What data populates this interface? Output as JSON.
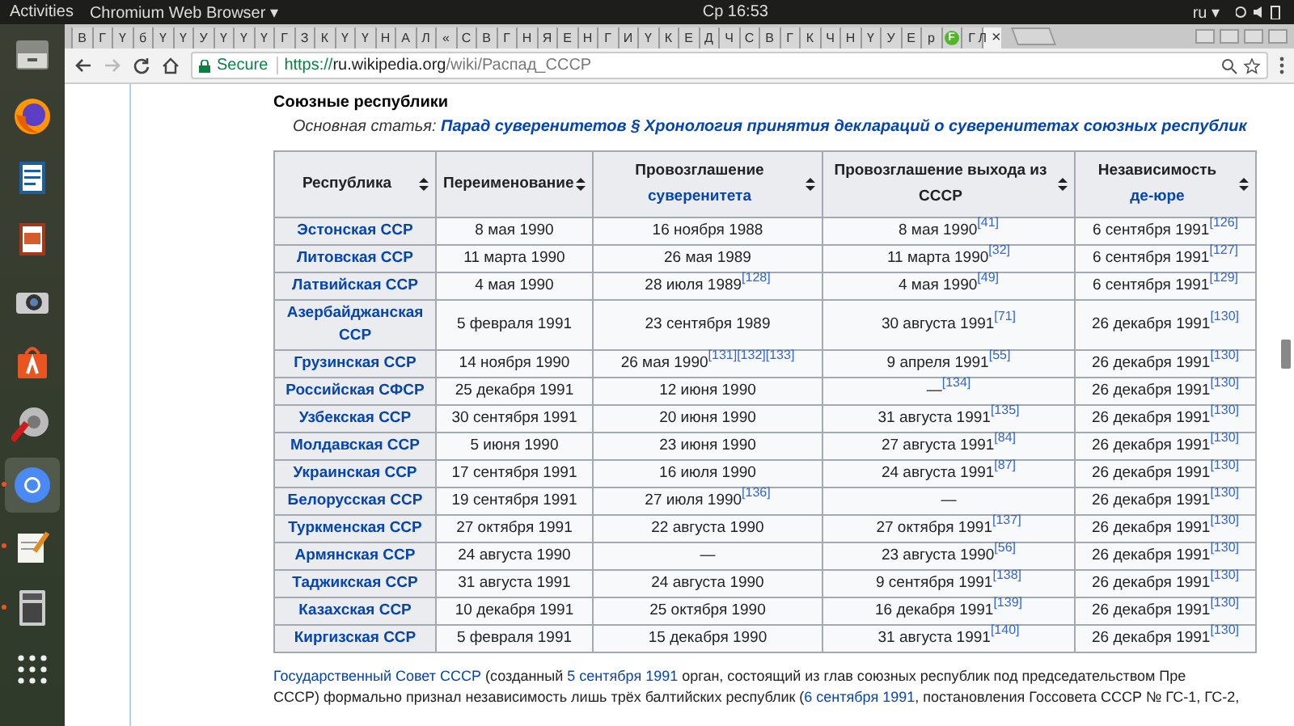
{
  "top_bar": {
    "activities": "Activities",
    "app_menu": "Chromium Web Browser ▾",
    "clock": "Ср 16:53",
    "keyboard": "ru ▾"
  },
  "dock": [
    {
      "kind": "files",
      "running": false,
      "selected": false
    },
    {
      "kind": "firefox",
      "running": false,
      "selected": false
    },
    {
      "kind": "writer",
      "running": false,
      "selected": false
    },
    {
      "kind": "impress",
      "running": false,
      "selected": false
    },
    {
      "kind": "camera",
      "running": false,
      "selected": false
    },
    {
      "kind": "software",
      "running": false,
      "selected": false
    },
    {
      "kind": "settings",
      "running": false,
      "selected": false
    },
    {
      "kind": "chromium",
      "running": true,
      "selected": true
    },
    {
      "kind": "editor",
      "running": true,
      "selected": false
    },
    {
      "kind": "calculator",
      "running": true,
      "selected": false
    },
    {
      "kind": "apps",
      "running": false,
      "selected": false
    }
  ],
  "tabs": [
    {
      "label": "В",
      "selected": false
    },
    {
      "label": "Г",
      "selected": false
    },
    {
      "label": "Ү",
      "selected": false
    },
    {
      "label": "б",
      "selected": false
    },
    {
      "label": "Ү",
      "selected": false
    },
    {
      "label": "Ү",
      "selected": false
    },
    {
      "label": "У",
      "selected": false
    },
    {
      "label": "Ү",
      "selected": false
    },
    {
      "label": "Ү",
      "selected": false
    },
    {
      "label": "Ү",
      "selected": false
    },
    {
      "label": "Г",
      "selected": false
    },
    {
      "label": "З",
      "selected": false
    },
    {
      "label": "К",
      "selected": false
    },
    {
      "label": "Ү",
      "selected": false
    },
    {
      "label": "Ү",
      "selected": false
    },
    {
      "label": "Н",
      "selected": false
    },
    {
      "label": "А",
      "selected": false
    },
    {
      "label": "Л",
      "selected": false
    },
    {
      "label": "«",
      "selected": false
    },
    {
      "label": "С",
      "selected": false
    },
    {
      "label": "В",
      "selected": false
    },
    {
      "label": "Г",
      "selected": false
    },
    {
      "label": "Н",
      "selected": false
    },
    {
      "label": "Я",
      "selected": false
    },
    {
      "label": "Е",
      "selected": false
    },
    {
      "label": "Н",
      "selected": false
    },
    {
      "label": "Г",
      "selected": false
    },
    {
      "label": "И",
      "selected": false
    },
    {
      "label": "Ү",
      "selected": false
    },
    {
      "label": "К",
      "selected": false
    },
    {
      "label": "Е",
      "selected": false
    },
    {
      "label": "Д",
      "selected": false
    },
    {
      "label": "Ч",
      "selected": false
    },
    {
      "label": "С",
      "selected": false
    },
    {
      "label": "В",
      "selected": false
    },
    {
      "label": "Г",
      "selected": false
    },
    {
      "label": "К",
      "selected": false
    },
    {
      "label": "Ч",
      "selected": false
    },
    {
      "label": "Н",
      "selected": false
    },
    {
      "label": "Ү",
      "selected": false
    },
    {
      "label": "У",
      "selected": false
    },
    {
      "label": "Е",
      "selected": false
    },
    {
      "label": "р",
      "selected": false
    },
    {
      "label": "F",
      "selected": false,
      "color": "#52b52a"
    },
    {
      "label": "Г",
      "selected": false
    },
    {
      "label": "Л",
      "selected": true
    }
  ],
  "tab_close": "×",
  "address_bar": {
    "secure": "Secure",
    "scheme": "https://",
    "host": "ru.wikipedia.org",
    "path": "/wiki/Распад_СССР"
  },
  "article": {
    "heading": "Союзные республики",
    "main_article": {
      "label": "Основная статья:",
      "link": "Парад суверенитетов § Хронология принятия деклараций о суверенитетах союзных республик"
    },
    "table": {
      "columns": [
        {
          "label": "Республика"
        },
        {
          "label": "Переименование"
        },
        {
          "label": "Провозглашение",
          "link": "суверенитета"
        },
        {
          "label": "Провозглашение выхода из СССР"
        },
        {
          "label": "Независимость",
          "link": "де-юре"
        }
      ],
      "rows": [
        [
          "Эстонская ССР",
          "8 мая 1990",
          "16 ноября 1988",
          "8 мая 1990$^{[41]}$",
          "6 сентября 1991$^{[126]}$"
        ],
        [
          "Литовская ССР",
          "11 марта 1990",
          "26 мая 1989",
          "11 марта 1990$^{[32]}$",
          "6 сентября 1991$^{[127]}$"
        ],
        [
          "Латвийская ССР",
          "4 мая 1990",
          "28 июля 1989$^{[128]}$",
          "4 мая 1990$^{[49]}$",
          "6 сентября 1991$^{[129]}$"
        ],
        [
          "Азербайджанская ССР",
          "5 февраля 1991",
          "23 сентября 1989",
          "30 августа 1991$^{[71]}$",
          "26 декабря 1991$^{[130]}$"
        ],
        [
          "Грузинская ССР",
          "14 ноября 1990",
          "26 мая 1990$^{[131][132][133]}$",
          "9 апреля 1991$^{[55]}$",
          "26 декабря 1991$^{[130]}$"
        ],
        [
          "Российская СФСР",
          "25 декабря 1991",
          "12 июня 1990",
          "—$^{[134]}$",
          "26 декабря 1991$^{[130]}$"
        ],
        [
          "Узбекская ССР",
          "30 сентября 1991",
          "20 июня 1990",
          "31 августа 1991$^{[135]}$",
          "26 декабря 1991$^{[130]}$"
        ],
        [
          "Молдавская ССР",
          "5 июня 1990",
          "23 июня 1990",
          "27 августа 1991$^{[84]}$",
          "26 декабря 1991$^{[130]}$"
        ],
        [
          "Украинская ССР",
          "17 сентября 1991",
          "16 июля 1990",
          "24 августа 1991$^{[87]}$",
          "26 декабря 1991$^{[130]}$"
        ],
        [
          "Белорусская ССР",
          "19 сентября 1991",
          "27 июля 1990$^{[136]}$",
          "—",
          "26 декабря 1991$^{[130]}$"
        ],
        [
          "Туркменская ССР",
          "27 октября 1991",
          "22 августа 1990",
          "27 октября 1991$^{[137]}$",
          "26 декабря 1991$^{[130]}$"
        ],
        [
          "Армянская ССР",
          "24 августа 1990",
          "—",
          "23 августа 1990$^{[56]}$",
          "26 декабря 1991$^{[130]}$"
        ],
        [
          "Таджикская ССР",
          "31 августа 1991",
          "24 августа 1990",
          "9 сентября 1991$^{[138]}$",
          "26 декабря 1991$^{[130]}$"
        ],
        [
          "Казахская ССР",
          "10 декабря 1991",
          "25 октября 1990",
          "16 декабря 1991$^{[139]}$",
          "26 декабря 1991$^{[130]}$"
        ],
        [
          "Киргизская ССР",
          "5 февраля 1991",
          "15 декабря 1990",
          "31 августа 1991$^{[140]}$",
          "26 декабря 1991$^{[130]}$"
        ]
      ]
    },
    "paragraph": [
      [
        {
          "text": "Государственный Совет СССР",
          "link": true
        },
        {
          "text": " (созданный ",
          "link": false
        },
        {
          "text": "5 сентября 1991",
          "link": true
        },
        {
          "text": " орган, состоящий из глав союзных республик под председательством Пре",
          "link": false
        }
      ],
      [
        {
          "text": "СССР) формально признал независимость лишь трёх балтийских республик (",
          "link": false
        },
        {
          "text": "6 сентября 1991",
          "link": true
        },
        {
          "text": ", постановления Госсовета СССР № ГС-1, ГС-2,",
          "link": false
        }
      ]
    ]
  }
}
